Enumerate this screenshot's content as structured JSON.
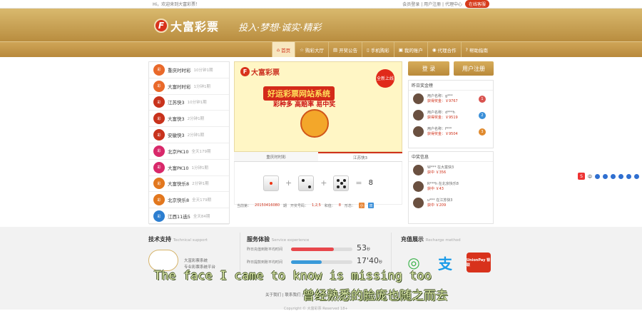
{
  "topbar": {
    "welcome": "Hi，欢迎来到大富彩票！",
    "links": "会员登录 | 用户注册 | 代理中心",
    "kefu": "在线客服"
  },
  "header": {
    "logo_letter": "F",
    "logo_name": "大富彩票",
    "slogan": "投入·梦想·诚实·精彩"
  },
  "nav": [
    {
      "label": "首页",
      "icon": "home-icon",
      "active": true
    },
    {
      "label": "购彩大厅",
      "icon": "star-icon"
    },
    {
      "label": "开奖公告",
      "icon": "chart-icon"
    },
    {
      "label": "手机购彩",
      "icon": "phone-icon"
    },
    {
      "label": "我的账户",
      "icon": "wallet-icon"
    },
    {
      "label": "代理合作",
      "icon": "user-icon"
    },
    {
      "label": "帮助指南",
      "icon": "help-icon"
    }
  ],
  "lottery": [
    {
      "name": "重庆时时彩",
      "freq": "10分钟1期",
      "color": "#e9692a"
    },
    {
      "name": "大富时时彩",
      "freq": "1分钟1期",
      "color": "#e9692a"
    },
    {
      "name": "江苏快3",
      "freq": "10分钟1期",
      "color": "#c8321c"
    },
    {
      "name": "大富快3",
      "freq": "2分钟1期",
      "color": "#c8321c"
    },
    {
      "name": "安徽快3",
      "freq": "2分钟1期",
      "color": "#c8321c"
    },
    {
      "name": "北京PK10",
      "freq": "全天179期",
      "color": "#d8286a"
    },
    {
      "name": "大富PK10",
      "freq": "1分钟1期",
      "color": "#d8286a"
    },
    {
      "name": "大富快乐8",
      "freq": "2分钟1期",
      "color": "#e2771e"
    },
    {
      "name": "北京快乐8",
      "freq": "全天179期",
      "color": "#e2771e"
    },
    {
      "name": "江西11选5",
      "freq": "全天84期",
      "color": "#2c7ed0"
    }
  ],
  "banner": {
    "logo": "大富彩票",
    "title": "好运彩票网站系统",
    "subtitle": "彩种多 高赔率 易中奖",
    "new_badge": "全新上线"
  },
  "tabs": [
    {
      "label": "重庆时时彩",
      "active": false
    },
    {
      "label": "江苏快3",
      "active": true
    }
  ],
  "draw": {
    "dice": [
      1,
      2,
      5
    ],
    "plus": "+",
    "equals": "=",
    "sum": "8",
    "issue_label": "当前第：",
    "issue": "20150416080",
    "issue_suffix": "期",
    "result_label": "开奖号码：",
    "result": "1,2,5",
    "sum_label": "和值：",
    "sum_value": "8",
    "shape_label": "形态：",
    "shape_a": "小",
    "shape_b": "双"
  },
  "auth": {
    "login": "登 录",
    "register": "用户注册"
  },
  "winners": {
    "title": "昨日奖金榜",
    "items": [
      {
        "name": "用户名称：g***",
        "prize": "获得奖金：￥9767",
        "rank": "1",
        "rank_color": "#d9534f"
      },
      {
        "name": "用户名称：d***h",
        "prize": "获得奖金：￥9519",
        "rank": "2",
        "rank_color": "#3a8fd8"
      },
      {
        "name": "用户名称：f***",
        "prize": "获得奖金：￥9504",
        "rank": "3",
        "rank_color": "#e08a2e"
      }
    ]
  },
  "news": {
    "title": "中奖信息",
    "items": [
      {
        "line1": "W*** 在大富快3",
        "line2": "获中 ￥356"
      },
      {
        "line1": "R***h 在北京快乐8",
        "line2": "获中 ￥43"
      },
      {
        "line1": "u*** 在江苏快3",
        "line2": "获中 ￥209"
      }
    ]
  },
  "sidetools": {
    "label": "中"
  },
  "support": {
    "title": "技术支持",
    "title_en": "Technical support",
    "line1": "大富彩票系统",
    "line2": "专业彩票系统平台"
  },
  "service": {
    "title": "服务体验",
    "title_en": "Service experience",
    "rows": [
      {
        "label": "昨日充值到账平均时间",
        "value": "53",
        "unit": "秒",
        "pct": 0.7,
        "color": "#e8474c"
      },
      {
        "label": "昨日提款到账平均时间",
        "value": "17'40",
        "unit": "秒",
        "pct": 0.5,
        "color": "#3a9ad9"
      }
    ]
  },
  "recharge": {
    "title": "充值展示",
    "title_en": "Recharge method",
    "methods": [
      {
        "name": "wechat-icon",
        "glyph": "◎",
        "color": "#3bb34a"
      },
      {
        "name": "alipay-icon",
        "glyph": "支",
        "color": "#1a9be8"
      },
      {
        "name": "unionpay-icon",
        "glyph": "UnionPay 银联",
        "color": "#d8321c"
      }
    ]
  },
  "subtitle_en": "The face I came to know is missing too",
  "subtitle_cn": "曾经熟悉的脸庞也随之而去",
  "footer": {
    "links": "关于我们 | 联系我们 | 常见问题",
    "copyright": "Copyright © 大富彩票 Reserved  18+"
  }
}
